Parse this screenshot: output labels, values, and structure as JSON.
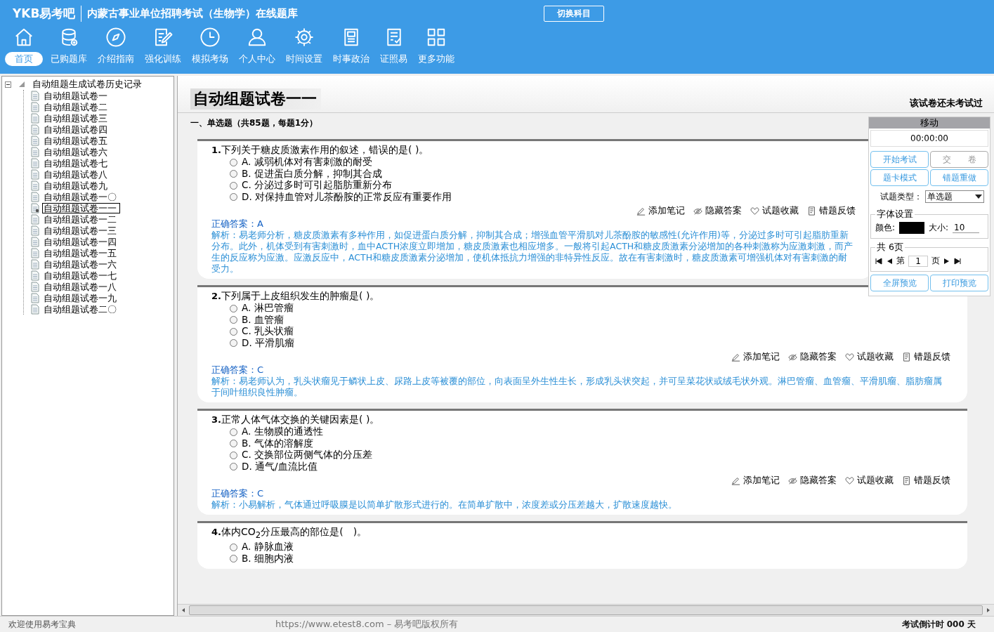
{
  "header": {
    "logo": "YKB易考吧",
    "title": "内蒙古事业单位招聘考试（生物学）在线题库",
    "switch_button": "切换科目"
  },
  "toolbar": [
    {
      "label": "首页",
      "selected": true
    },
    {
      "label": "已购题库",
      "selected": false
    },
    {
      "label": "介绍指南",
      "selected": false
    },
    {
      "label": "强化训练",
      "selected": false
    },
    {
      "label": "模拟考场",
      "selected": false
    },
    {
      "label": "个人中心",
      "selected": false
    },
    {
      "label": "时间设置",
      "selected": false
    },
    {
      "label": "时事政治",
      "selected": false
    },
    {
      "label": "证照易",
      "selected": false
    },
    {
      "label": "更多功能",
      "selected": false
    }
  ],
  "tree": {
    "label": "自动组题生成试卷历史记录",
    "expanded": true,
    "children": [
      {
        "label": "自动组题试卷一",
        "selected": false
      },
      {
        "label": "自动组题试卷二",
        "selected": false
      },
      {
        "label": "自动组题试卷三",
        "selected": false
      },
      {
        "label": "自动组题试卷四",
        "selected": false
      },
      {
        "label": "自动组题试卷五",
        "selected": false
      },
      {
        "label": "自动组题试卷六",
        "selected": false
      },
      {
        "label": "自动组题试卷七",
        "selected": false
      },
      {
        "label": "自动组题试卷八",
        "selected": false
      },
      {
        "label": "自动组题试卷九",
        "selected": false
      },
      {
        "label": "自动组题试卷一〇",
        "selected": false
      },
      {
        "label": "自动组题试卷一一",
        "selected": true
      },
      {
        "label": "自动组题试卷一二",
        "selected": false
      },
      {
        "label": "自动组题试卷一三",
        "selected": false
      },
      {
        "label": "自动组题试卷一四",
        "selected": false
      },
      {
        "label": "自动组题试卷一五",
        "selected": false
      },
      {
        "label": "自动组题试卷一六",
        "selected": false
      },
      {
        "label": "自动组题试卷一七",
        "selected": false
      },
      {
        "label": "自动组题试卷一八",
        "selected": false
      },
      {
        "label": "自动组题试卷一九",
        "selected": false
      },
      {
        "label": "自动组题试卷二〇",
        "selected": false
      }
    ]
  },
  "paper": {
    "title": "自动组题试卷一一",
    "status": "该试卷还未考试过",
    "section": "一、单选题（共85题，每题1分）"
  },
  "questions": [
    {
      "number": "1.",
      "text": "下列关于糖皮质激素作用的叙述，错误的是( )。",
      "options": [
        {
          "letter": "A.",
          "text": "减弱机体对有害刺激的耐受",
          "selected": false
        },
        {
          "letter": "B.",
          "text": "促进蛋白质分解，抑制其合成",
          "selected": false
        },
        {
          "letter": "C.",
          "text": "分泌过多时可引起脂肪重新分布",
          "selected": false
        },
        {
          "letter": "D.",
          "text": "对保持血管对儿茶酚胺的正常反应有重要作用",
          "selected": false
        }
      ],
      "actions": [
        "添加笔记",
        "隐藏答案",
        "试题收藏",
        "错题反馈"
      ],
      "answer_label": "正确答案：",
      "answer": "A",
      "explanation": "解析：易老师分析，糖皮质激素有多种作用，如促进蛋白质分解，抑制其合成；增强血管平滑肌对儿茶酚胺的敏感性(允许作用)等，分泌过多时可引起脂肪重新分布。此外，机体受到有害刺激时，血中ACTH浓度立即增加，糖皮质激素也相应增多。一般将引起ACTH和糖皮质激素分泌增加的各种刺激称为应激刺激，而产生的反应称为应激。应激反应中，ACTH和糖皮质激素分泌增加，使机体抵抗力增强的非特异性反应。故在有害刺激时，糖皮质激素可增强机体对有害刺激的耐受力。"
    },
    {
      "number": "2.",
      "text": "下列属于上皮组织发生的肿瘤是( )。",
      "options": [
        {
          "letter": "A.",
          "text": "淋巴管瘤",
          "selected": false
        },
        {
          "letter": "B.",
          "text": "血管瘤",
          "selected": false
        },
        {
          "letter": "C.",
          "text": "乳头状瘤",
          "selected": false
        },
        {
          "letter": "D.",
          "text": "平滑肌瘤",
          "selected": false
        }
      ],
      "actions": [
        "添加笔记",
        "隐藏答案",
        "试题收藏",
        "错题反馈"
      ],
      "answer_label": "正确答案：",
      "answer": "C",
      "explanation": "解析：易老师认为，乳头状瘤见于鳞状上皮、尿路上皮等被覆的部位，向表面呈外生性生长，形成乳头状突起，并可呈菜花状或绒毛状外观。淋巴管瘤、血管瘤、平滑肌瘤、脂肪瘤属于间叶组织良性肿瘤。"
    },
    {
      "number": "3.",
      "text": "正常人体气体交换的关键因素是( )。",
      "options": [
        {
          "letter": "A.",
          "text": "生物膜的通透性",
          "selected": false
        },
        {
          "letter": "B.",
          "text": "气体的溶解度",
          "selected": false
        },
        {
          "letter": "C.",
          "text": "交换部位两侧气体的分压差",
          "selected": false
        },
        {
          "letter": "D.",
          "text": "通气/血流比值",
          "selected": false
        }
      ],
      "actions": [
        "添加笔记",
        "隐藏答案",
        "试题收藏",
        "错题反馈"
      ],
      "answer_label": "正确答案：",
      "answer": "C",
      "explanation": "解析：小易解析，气体通过呼吸膜是以简单扩散形式进行的。在简单扩散中，浓度差或分压差越大，扩散速度越快。"
    },
    {
      "number": "4.",
      "text": "体内CO$_{2}$分压最高的部位是(　)。",
      "options": [
        {
          "letter": "A.",
          "text": "静脉血液",
          "selected": false
        },
        {
          "letter": "B.",
          "text": "细胞内液",
          "selected": false
        }
      ]
    }
  ],
  "control_panel": {
    "header": "移动",
    "timer": "00:00:00",
    "buttons": [
      {
        "label": "开始考试",
        "disabled": false
      },
      {
        "label": "交　　卷",
        "disabled": true
      },
      {
        "label": "题卡模式",
        "disabled": false
      },
      {
        "label": "错题重做",
        "disabled": false
      }
    ],
    "type_label": "试题类型：",
    "type_value": "单选题",
    "font_group": "字体设置",
    "color_label": "颜色:",
    "color": "#000000",
    "size_label": "大小:",
    "size_value": "10",
    "pages_group": "共 6页",
    "page_prefix": "第",
    "page_value": "1",
    "page_suffix": "页",
    "bottom_buttons": [
      "全屏预览",
      "打印预览"
    ]
  },
  "status_bar": {
    "welcome": "欢迎使用易考宝典",
    "copyright": "https://www.etest8.com – 易考吧版权所有",
    "countdown": "考试倒计时 000 天"
  }
}
